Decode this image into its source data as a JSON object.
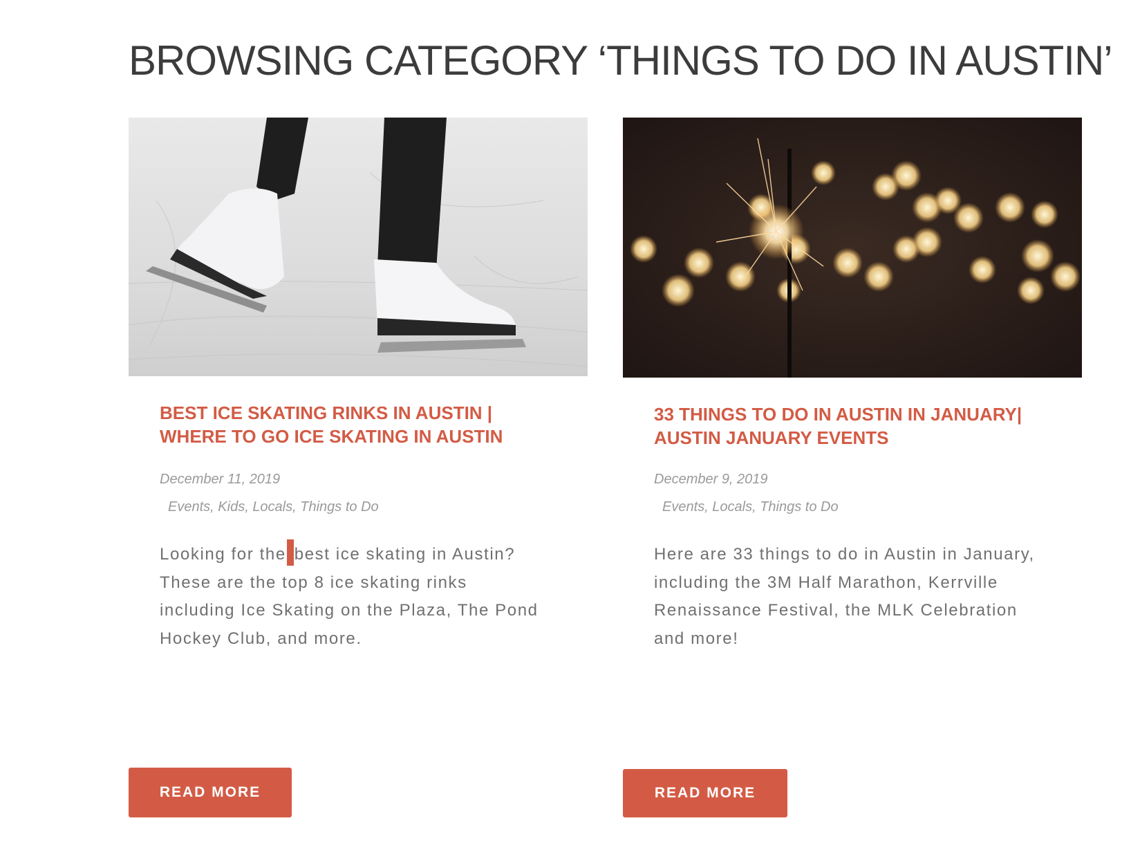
{
  "page": {
    "title": "BROWSING CATEGORY ‘THINGS TO DO IN AUSTIN’"
  },
  "posts": [
    {
      "title": "BEST ICE SKATING RINKS IN AUSTIN | WHERE TO GO ICE SKATING IN AUSTIN",
      "date": "December 11, 2019",
      "categories": [
        "Events",
        "Kids",
        "Locals",
        "Things to Do"
      ],
      "excerpt_before_cursor": "Looking for the",
      "excerpt_after_cursor": "best ice skating in Austin? These are the top 8 ice skating rinks including Ice Skating on the Plaza, The Pond Hockey Club, and more.",
      "image": "ice-skates-on-rink-photo",
      "read_more_label": "READ MORE"
    },
    {
      "title": "33 THINGS TO DO IN AUSTIN IN JANUARY| AUSTIN JANUARY EVENTS",
      "date": "December 9, 2019",
      "categories": [
        "Events",
        "Locals",
        "Things to Do"
      ],
      "excerpt": "Here are 33 things to do in Austin in January, including the 3M Half Marathon, Kerrville Renaissance Festival, the MLK Celebration and more!",
      "image": "sparkler-bokeh-lights-photo",
      "read_more_label": "READ MORE"
    }
  ],
  "colors": {
    "accent": "#d35b45",
    "title_text": "#3c3c3c",
    "meta_text": "#9a9a9a",
    "body_text": "#707070",
    "button_text": "#ffffff"
  }
}
